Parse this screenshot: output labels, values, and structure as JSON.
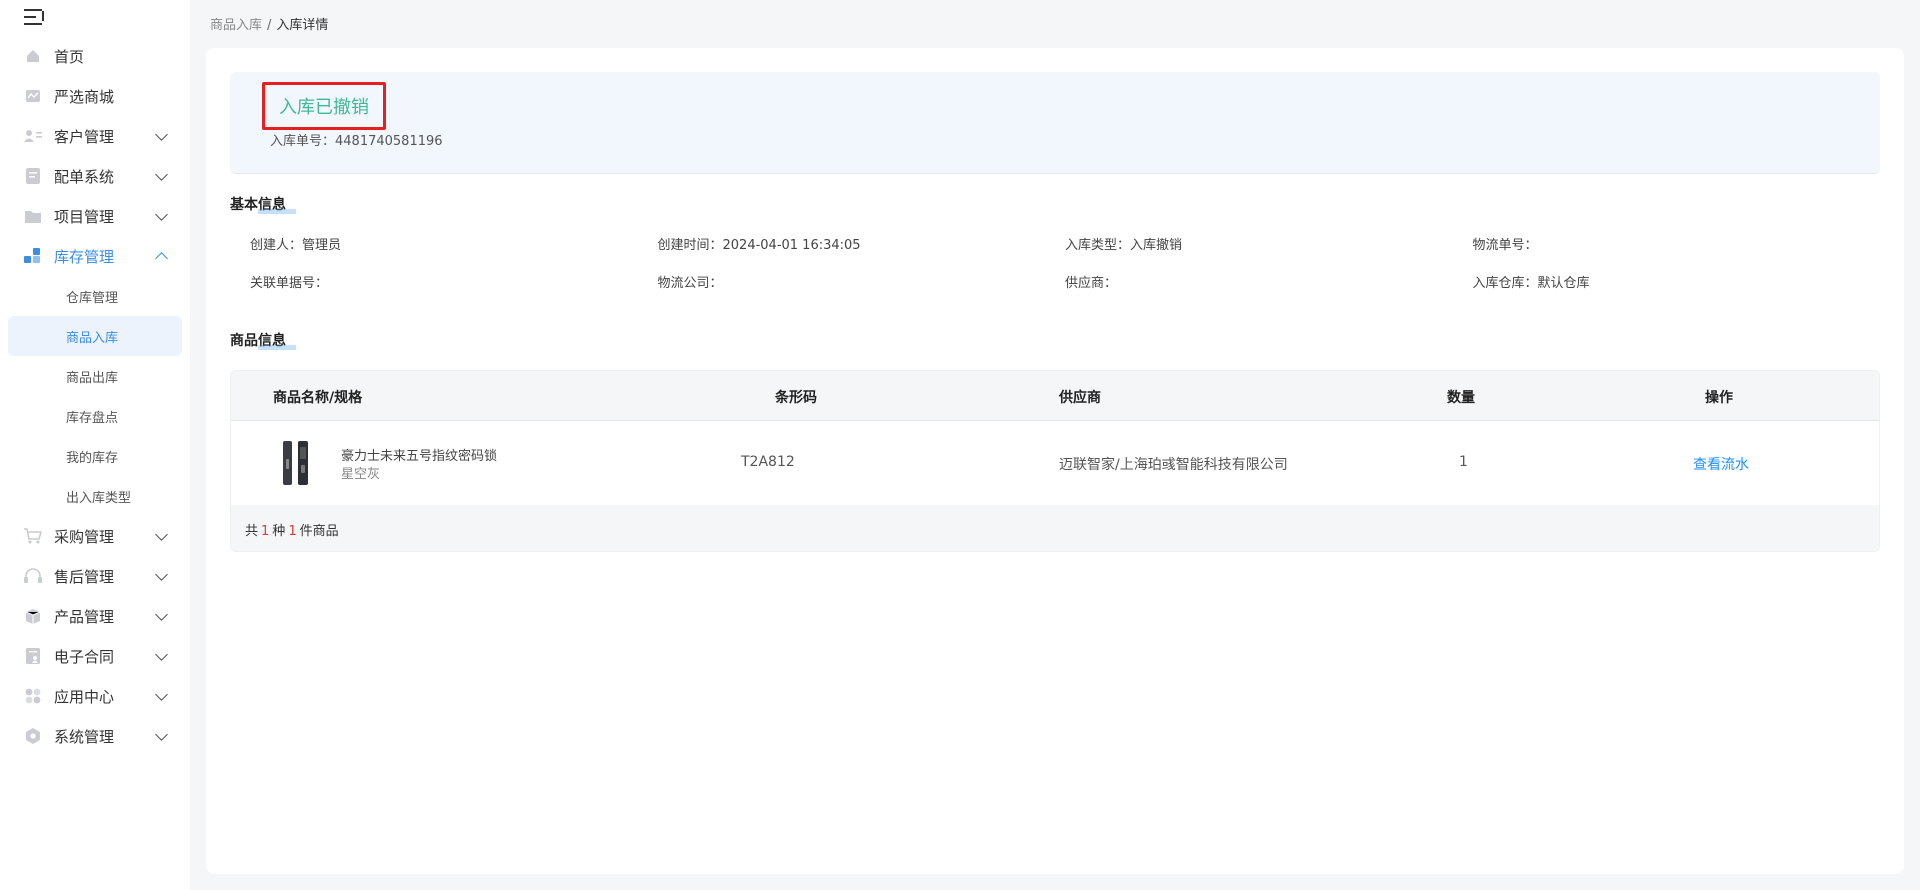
{
  "breadcrumb": {
    "parent": "商品入库",
    "separator": "/",
    "current": "入库详情"
  },
  "sidebar": {
    "items": [
      {
        "label": "首页"
      },
      {
        "label": "严选商城"
      },
      {
        "label": "客户管理"
      },
      {
        "label": "配单系统"
      },
      {
        "label": "项目管理"
      },
      {
        "label": "库存管理"
      },
      {
        "label": "采购管理"
      },
      {
        "label": "售后管理"
      },
      {
        "label": "产品管理"
      },
      {
        "label": "电子合同"
      },
      {
        "label": "应用中心"
      },
      {
        "label": "系统管理"
      }
    ],
    "sub_items": [
      {
        "label": "仓库管理"
      },
      {
        "label": "商品入库"
      },
      {
        "label": "商品出库"
      },
      {
        "label": "库存盘点"
      },
      {
        "label": "我的库存"
      },
      {
        "label": "出入库类型"
      }
    ]
  },
  "status": {
    "title": "入库已撤销",
    "order_no": "入库单号：4481740581196"
  },
  "basic": {
    "title": "基本信息",
    "creator": "创建人：管理员",
    "created_at": "创建时间：2024-04-01 16:34:05",
    "type": "入库类型：入库撤销",
    "logistics_no": "物流单号：",
    "related_no": "关联单据号：",
    "logistics_company": "物流公司：",
    "supplier": "供应商：",
    "warehouse": "入库仓库：默认仓库"
  },
  "goods": {
    "title": "商品信息",
    "columns": [
      "商品名称/规格",
      "条形码",
      "供应商",
      "数量",
      "操作"
    ],
    "rows": [
      {
        "name": "豪力士未来五号指纹密码锁",
        "spec": "星空灰",
        "barcode": "T2A812",
        "supplier": "迈联智家/上海珀彧智能科技有限公司",
        "qty": "1",
        "action": "查看流水"
      }
    ],
    "footer": {
      "prefix": "共",
      "kinds": "1",
      "mid": "种",
      "count": "1",
      "suffix": "件商品"
    }
  },
  "colors": {
    "accent": "#3a8ee6",
    "status_green": "#3fb89a",
    "highlight_red": "#e52020",
    "link": "#1e90ff"
  }
}
